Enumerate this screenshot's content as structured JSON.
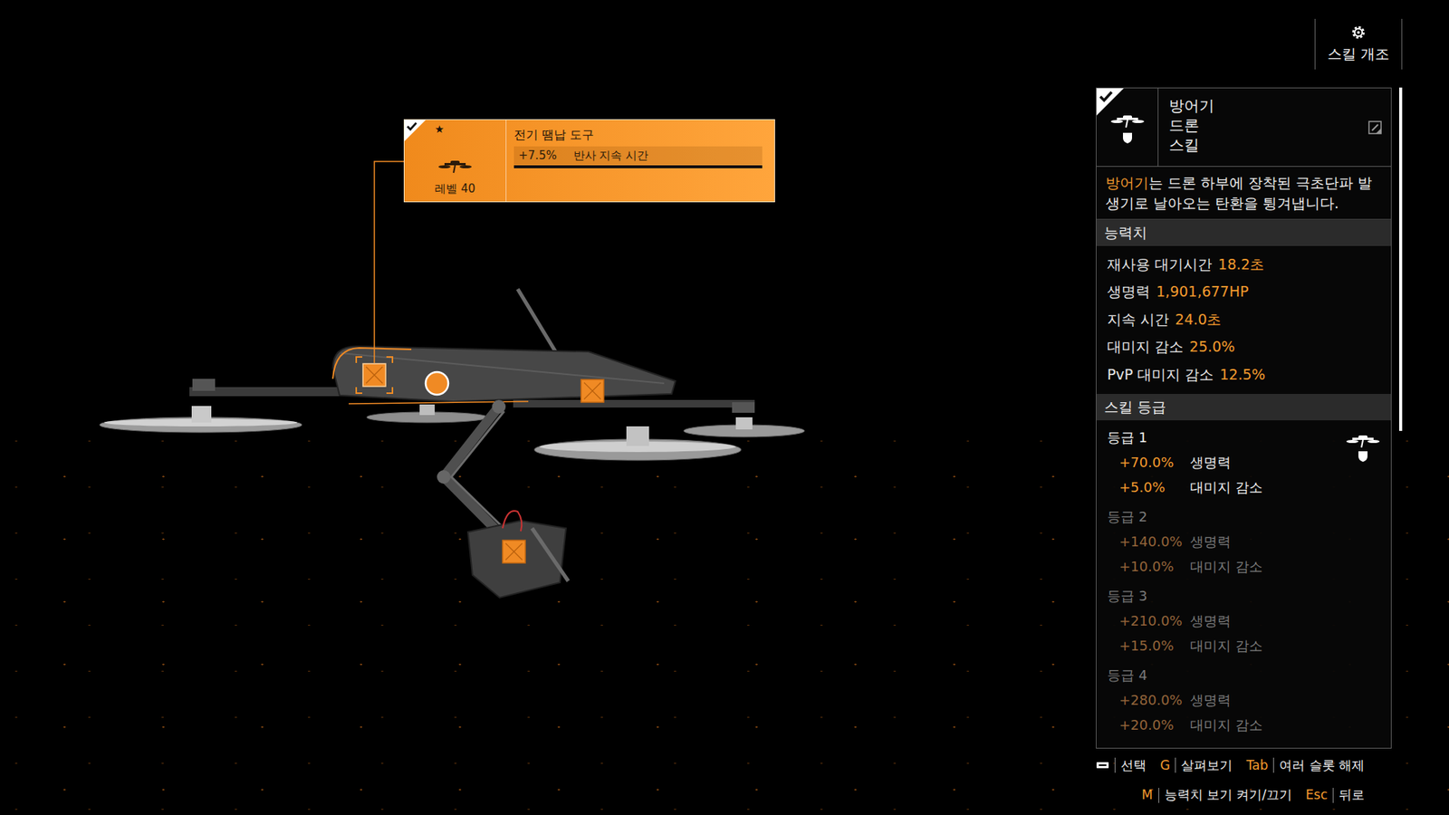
{
  "header": {
    "title": "스킬 개조"
  },
  "mod_slots": [
    {
      "kind": "square",
      "selected": true
    },
    {
      "kind": "circle",
      "selected": false
    },
    {
      "kind": "square",
      "selected": false
    },
    {
      "kind": "square",
      "selected": false
    }
  ],
  "tooltip": {
    "equipped": true,
    "star": "★",
    "level": "레벨 40",
    "name": "전기 땜납 도구",
    "stat": {
      "value": "+7.5%",
      "label": "반사 지속 시간",
      "level": 1
    }
  },
  "skill": {
    "equipped": true,
    "title_lines": [
      "방어기",
      "드론",
      "스킬"
    ],
    "description": [
      {
        "text": "방어기",
        "highlight": true
      },
      {
        "text": "는 드론 하부에 장착된 극초단파 발생기로 날아오는 탄환을 튕겨냅니다.",
        "highlight": false
      }
    ],
    "stats_title": "능력치",
    "stats": [
      {
        "label": "재사용 대기시간",
        "value": "18.2초"
      },
      {
        "label": "생명력",
        "value": "1,901,677HP"
      },
      {
        "label": "지속 시간",
        "value": "24.0초"
      },
      {
        "label": "대미지 감소",
        "value": "25.0%"
      },
      {
        "label": "PvP 대미지 감소",
        "value": "12.5%"
      }
    ],
    "tiers_title": "스킬 등급",
    "tiers": [
      {
        "label": "등급 1",
        "active": true,
        "bonuses": [
          {
            "value": "+70.0%",
            "label": "생명력"
          },
          {
            "value": "+5.0%",
            "label": "대미지 감소"
          }
        ]
      },
      {
        "label": "등급 2",
        "active": false,
        "bonuses": [
          {
            "value": "+140.0%",
            "label": "생명력"
          },
          {
            "value": "+10.0%",
            "label": "대미지 감소"
          }
        ]
      },
      {
        "label": "등급 3",
        "active": false,
        "bonuses": [
          {
            "value": "+210.0%",
            "label": "생명력"
          },
          {
            "value": "+15.0%",
            "label": "대미지 감소"
          }
        ]
      },
      {
        "label": "등급 4",
        "active": false,
        "bonuses": [
          {
            "value": "+280.0%",
            "label": "생명력"
          },
          {
            "value": "+20.0%",
            "label": "대미지 감소"
          }
        ]
      }
    ]
  },
  "scrollbar": {
    "level": 0.52
  },
  "hint_rows": [
    [
      {
        "kind": "icon",
        "label": "선택"
      },
      {
        "kind": "key",
        "key": "G",
        "label": "살펴보기"
      },
      {
        "kind": "key",
        "key": "Tab",
        "label": "여러 슬롯 해제"
      }
    ],
    [
      {
        "kind": "key",
        "key": "M",
        "label": "능력치 보기 켜기/끄기"
      },
      {
        "kind": "key",
        "key": "Esc",
        "label": "뒤로"
      }
    ]
  ]
}
